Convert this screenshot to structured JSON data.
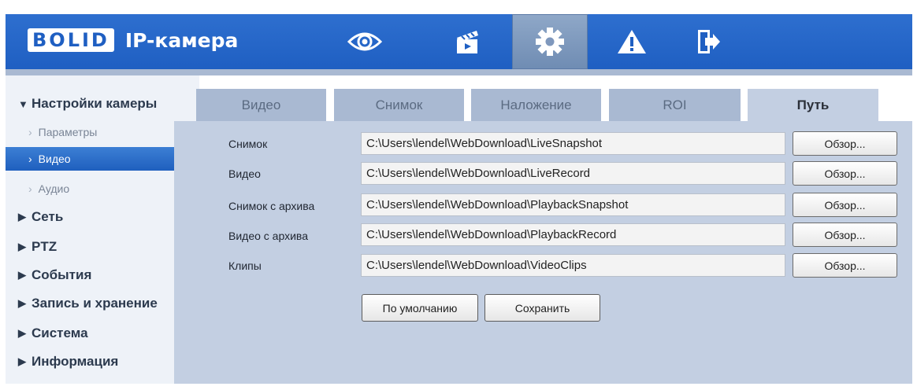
{
  "header": {
    "logo": "BOLID",
    "title": "IP-камера",
    "icons": [
      "eye-icon",
      "clapperboard-icon",
      "gear-icon",
      "warning-icon",
      "logout-icon"
    ],
    "active_icon": "gear-icon",
    "colors": {
      "header_bg": "#1f5fc2",
      "active_bg": "#7f98bd"
    }
  },
  "sidebar": {
    "camera_settings": "Настройки камеры",
    "sub_items": [
      "Параметры",
      "Видео",
      "Аудио"
    ],
    "active_sub": "Видео",
    "categories": [
      "Сеть",
      "PTZ",
      "События",
      "Запись и хранение",
      "Система",
      "Информация"
    ]
  },
  "tabs": [
    "Видео",
    "Снимок",
    "Наложение",
    "ROI",
    "Путь"
  ],
  "active_tab": "Путь",
  "paths": [
    {
      "label": "Снимок",
      "value": "C:\\Users\\lendel\\WebDownload\\LiveSnapshot",
      "button": "Обзор..."
    },
    {
      "label": "Видео",
      "value": "C:\\Users\\lendel\\WebDownload\\LiveRecord",
      "button": "Обзор..."
    },
    {
      "label": "Снимок с архива",
      "value": "C:\\Users\\lendel\\WebDownload\\PlaybackSnapshot",
      "button": "Обзор..."
    },
    {
      "label": "Видео с архива",
      "value": "C:\\Users\\lendel\\WebDownload\\PlaybackRecord",
      "button": "Обзор..."
    },
    {
      "label": "Клипы",
      "value": "C:\\Users\\lendel\\WebDownload\\VideoClips",
      "button": "Обзор..."
    }
  ],
  "actions": {
    "default": "По умолчанию",
    "save": "Сохранить"
  }
}
